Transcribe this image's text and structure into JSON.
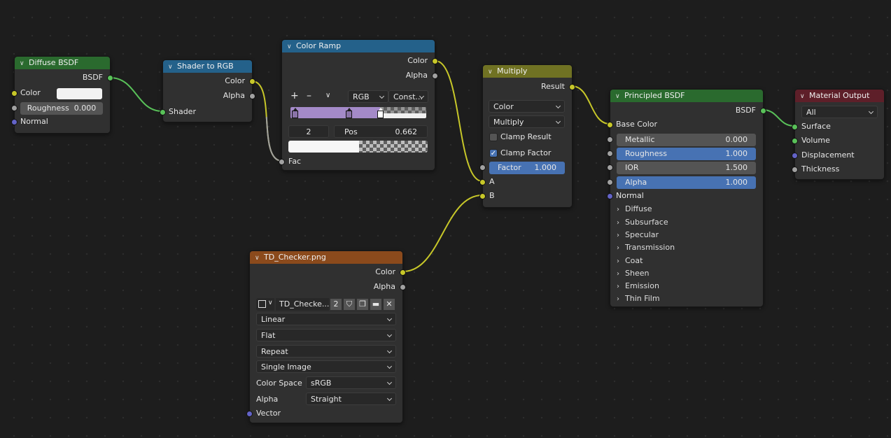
{
  "colors": {
    "green_header": "#2a6a2e",
    "blue_header": "#24618a",
    "olive_header": "#707223",
    "orange_header": "#8b4a1c",
    "red_header": "#5e1f29",
    "socket_color": "#c7c729",
    "socket_shader": "#59c159",
    "socket_float": "#a1a1a1",
    "socket_vector": "#6363c7",
    "accent_blue": "#4772b3",
    "ramp_purple": "#a48ac8"
  },
  "diffuse": {
    "title": "Diffuse BSDF",
    "out_bsdf": "BSDF",
    "in_color": "Color",
    "roughness_label": "Roughness",
    "roughness_value": "0.000",
    "in_normal": "Normal"
  },
  "shader_rgb": {
    "title": "Shader to RGB",
    "out_color": "Color",
    "out_alpha": "Alpha",
    "in_shader": "Shader"
  },
  "color_ramp": {
    "title": "Color Ramp",
    "out_color": "Color",
    "out_alpha": "Alpha",
    "add_label": "+",
    "remove_label": "–",
    "mode_value": "RGB",
    "interp_value": "Const...",
    "active_index": "2",
    "pos_label": "Pos",
    "pos_value": "0.662",
    "in_fac": "Fac",
    "stop_positions": [
      0.03,
      0.43,
      0.662
    ]
  },
  "multiply": {
    "title": "Multiply",
    "out_result": "Result",
    "type_value": "Color",
    "blend_value": "Multiply",
    "clamp_result": "Clamp Result",
    "clamp_result_checked": false,
    "clamp_factor": "Clamp Factor",
    "clamp_factor_checked": true,
    "factor_label": "Factor",
    "factor_value": "1.000",
    "in_a": "A",
    "in_b": "B"
  },
  "principled": {
    "title": "Principled BSDF",
    "out_bsdf": "BSDF",
    "base_color": "Base Color",
    "metallic_label": "Metallic",
    "metallic_value": "0.000",
    "roughness_label": "Roughness",
    "roughness_value": "1.000",
    "ior_label": "IOR",
    "ior_value": "1.500",
    "alpha_label": "Alpha",
    "alpha_value": "1.000",
    "normal": "Normal",
    "panels": [
      "Diffuse",
      "Subsurface",
      "Specular",
      "Transmission",
      "Coat",
      "Sheen",
      "Emission",
      "Thin Film"
    ]
  },
  "output": {
    "title": "Material Output",
    "target_value": "All",
    "surface": "Surface",
    "volume": "Volume",
    "displacement": "Displacement",
    "thickness": "Thickness"
  },
  "image": {
    "title": "TD_Checker.png",
    "out_color": "Color",
    "out_alpha": "Alpha",
    "image_name": "TD_Checke...",
    "users": "2",
    "interpolation": "Linear",
    "projection": "Flat",
    "extension": "Repeat",
    "source": "Single Image",
    "color_space_label": "Color Space",
    "color_space_value": "sRGB",
    "alpha_label": "Alpha",
    "alpha_value": "Straight",
    "in_vector": "Vector"
  }
}
